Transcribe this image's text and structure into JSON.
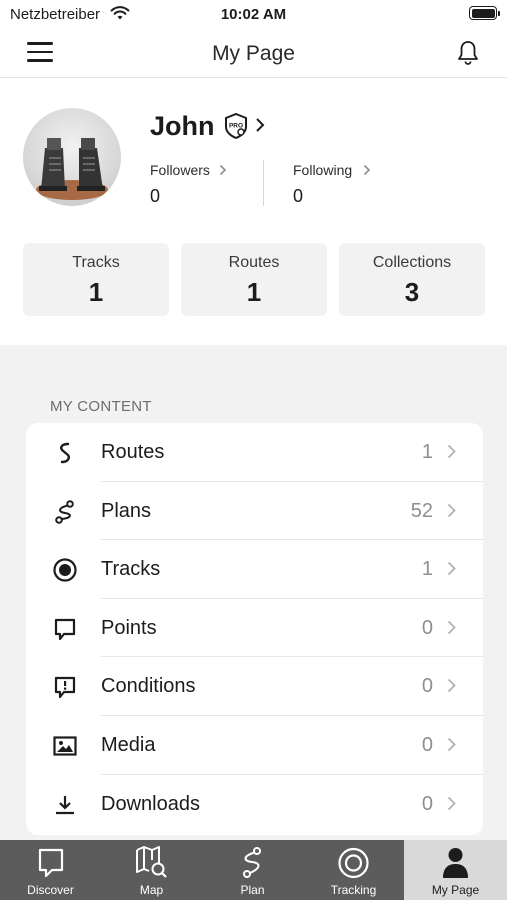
{
  "status_bar": {
    "carrier": "Netzbetreiber",
    "time": "10:02 AM"
  },
  "nav": {
    "title": "My Page"
  },
  "profile": {
    "name": "John",
    "followers_label": "Followers",
    "followers_count": "0",
    "following_label": "Following",
    "following_count": "0"
  },
  "counts": [
    {
      "label": "Tracks",
      "value": "1"
    },
    {
      "label": "Routes",
      "value": "1"
    },
    {
      "label": "Collections",
      "value": "3"
    }
  ],
  "my_content": {
    "header": "MY CONTENT",
    "items": [
      {
        "label": "Routes",
        "count": "1",
        "icon": "route-icon"
      },
      {
        "label": "Plans",
        "count": "52",
        "icon": "plan-icon"
      },
      {
        "label": "Tracks",
        "count": "1",
        "icon": "track-icon"
      },
      {
        "label": "Points",
        "count": "0",
        "icon": "point-icon"
      },
      {
        "label": "Conditions",
        "count": "0",
        "icon": "condition-icon"
      },
      {
        "label": "Media",
        "count": "0",
        "icon": "media-icon"
      },
      {
        "label": "Downloads",
        "count": "0",
        "icon": "download-icon"
      }
    ]
  },
  "tabs": [
    {
      "label": "Discover",
      "icon": "discover-icon"
    },
    {
      "label": "Map",
      "icon": "map-icon"
    },
    {
      "label": "Plan",
      "icon": "plan-icon"
    },
    {
      "label": "Tracking",
      "icon": "tracking-icon"
    },
    {
      "label": "My Page",
      "icon": "profile-icon",
      "active": true
    }
  ],
  "colors": {
    "tab_bar": "#5c5c5c",
    "tab_active": "#d9d9d9",
    "content_bg": "#f2f2f2"
  }
}
